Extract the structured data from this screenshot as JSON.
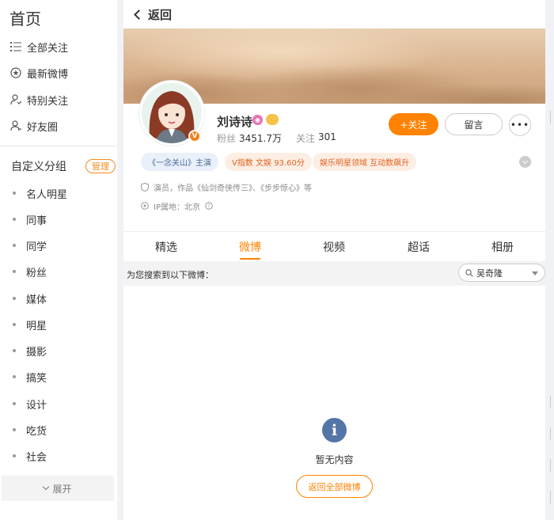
{
  "sidebar": {
    "title": "首页",
    "nav": [
      {
        "label": "全部关注",
        "icon": "list-icon"
      },
      {
        "label": "最新微博",
        "icon": "star-circle-icon"
      },
      {
        "label": "特别关注",
        "icon": "user-heart-icon"
      },
      {
        "label": "好友圈",
        "icon": "user-friends-icon"
      }
    ],
    "group_title": "自定义分组",
    "manage_label": "管理",
    "groups": [
      "名人明星",
      "同事",
      "同学",
      "粉丝",
      "媒体",
      "明星",
      "摄影",
      "搞笑",
      "设计",
      "吃货",
      "社会"
    ],
    "expand_label": "展开"
  },
  "header": {
    "back_label": "返回"
  },
  "profile": {
    "name": "刘诗诗",
    "verified_badge": "V",
    "followers_label": "粉丝",
    "followers_value": "3451.7万",
    "following_label": "关注",
    "following_value": "301",
    "follow_label": "+关注",
    "message_label": "留言",
    "more_label": "•••",
    "tags": [
      "《一念关山》主演",
      "V指数 文娱 93.60分",
      "娱乐明星领域 互动数飙升"
    ],
    "intro": "演员，作品《仙剑奇侠传三》、《步步惊心》等",
    "ip_location": "IP属地：北京"
  },
  "tabs": {
    "items": [
      "精选",
      "微博",
      "视频",
      "超话",
      "相册"
    ],
    "active_index": 1
  },
  "search": {
    "label": "为您搜索到以下微博：",
    "value": "吴奇隆"
  },
  "empty_state": {
    "message": "暂无内容",
    "button_label": "返回全部微博"
  },
  "colors": {
    "accent": "#ff8200",
    "info_icon": "#5475a8"
  }
}
